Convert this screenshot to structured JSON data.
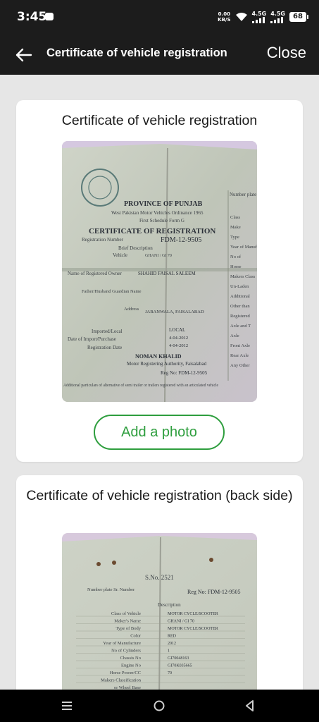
{
  "status_bar": {
    "time": "3:45",
    "net_speed_value": "0.00",
    "net_speed_unit": "KB/S",
    "signal1_label": "4.5G",
    "signal2_label": "4.5G",
    "battery": "68"
  },
  "app_bar": {
    "title": "Certificate of vehicle registration",
    "close_label": "Close"
  },
  "cards": {
    "front": {
      "title": "Certificate of vehicle registration",
      "add_photo_label": "Add a photo",
      "photo_text": {
        "province": "PROVINCE OF PUNJAB",
        "ordinance": "West Pakistan Motor Vehicles Ordinance 1965",
        "schedule": "First Schedule Form G",
        "certificate": "CERTIFICATE OF REGISTRATION",
        "reg_number_label": "Registration Number",
        "reg_number": "FDM-12-9505",
        "brief_desc": "Brief Description",
        "vehicle_label": "Vehicle",
        "vehicle_value": "GHANI / GI 70",
        "owner_label": "Name of Registered Owner",
        "owner_value": "SHAHID FAISAL SALEEM",
        "guardian_label": "Father/Husband Guardian Name",
        "address_label": "Address",
        "address_value": "JARANWALA, FAISALABAD",
        "imported_label": "Imported/Local",
        "imported_value": "LOCAL",
        "import_date_label": "Date of Import/Purchase",
        "import_date_value": "4-04-2012",
        "reg_date_label": "Registration Date",
        "reg_date_value": "4-04-2012",
        "officer": "NOMAN KHALID",
        "authority": "Motor Registering Authority, Faisalabad",
        "reg_no_footer": "Reg No: FDM-12-9505",
        "additional": "Additional particulars of alternative of semi trailer or trailers registered with an articulated vehicle",
        "number_plate": "Number plate",
        "right_col": [
          "Class",
          "Make",
          "Type",
          "Year of Manufacture",
          "No of",
          "Horse",
          "Makers Class",
          "Un-Laden",
          "Additional",
          "Other than",
          "Registered",
          "Axle and T",
          "Axle",
          "Front Axle",
          "Rear Axle",
          "Any Other"
        ]
      }
    },
    "back": {
      "title": "Certificate of vehicle registration (back side)",
      "photo_text": {
        "serial": "S.No. 2521",
        "reg_no": "Reg No: FDM-12-9505",
        "number_plate": "Number plate Sr. Number",
        "description": "Description",
        "rows": [
          {
            "label": "Class of Vehicle",
            "value": "MOTOR CYCLE/SCOOTER"
          },
          {
            "label": "Maker's Name",
            "value": "GHANI / GI 70"
          },
          {
            "label": "Type of Body",
            "value": "MOTOR CYCLE/SCOOTER"
          },
          {
            "label": "Color",
            "value": "RED"
          },
          {
            "label": "Year of Manufacture",
            "value": "2012"
          },
          {
            "label": "No of Cylinders",
            "value": "1"
          },
          {
            "label": "Chassis No",
            "value": "GI70048163"
          },
          {
            "label": "Engine No",
            "value": "GI70K035665"
          },
          {
            "label": "Horse Power/CC",
            "value": "70"
          },
          {
            "label": "Makers Classification",
            "value": ""
          },
          {
            "label": "or Wheel Base",
            "value": ""
          }
        ]
      }
    }
  },
  "nav": {
    "menu_icon": "menu-icon",
    "home_icon": "home-icon",
    "back_icon": "back-triangle-icon"
  },
  "colors": {
    "bar_bg": "#1c1c1c",
    "accent_green": "#2e9e3e",
    "page_bg": "#e6e6e6"
  }
}
